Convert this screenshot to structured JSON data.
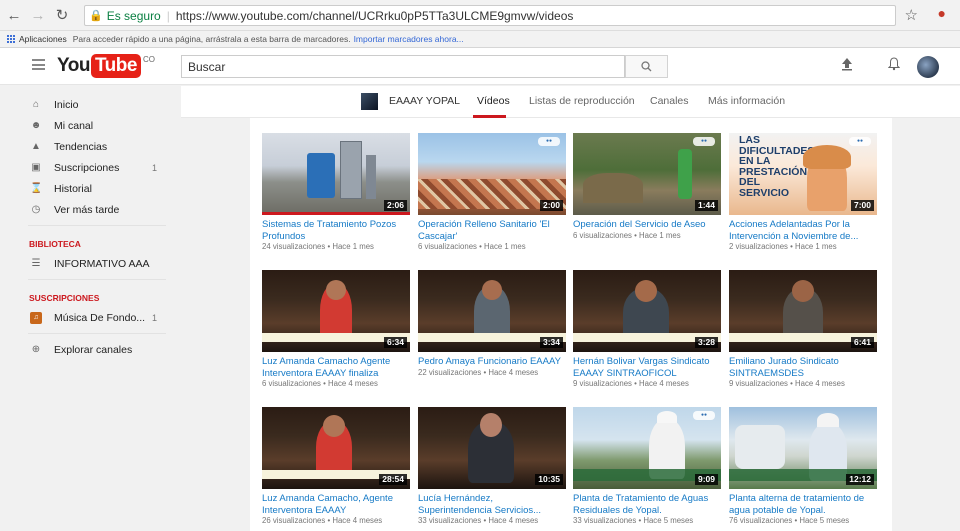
{
  "browser": {
    "secure_label": "Es seguro",
    "url": "https://www.youtube.com/channel/UCRrku0pP5TTa3ULCME9gmvw/videos",
    "bookmarks_apps": "Aplicaciones",
    "bookmarks_hint": "Para acceder rápido a una página, arrástrala a esta barra de marcadores.",
    "bookmarks_import": "Importar marcadores ahora..."
  },
  "masthead": {
    "logo_you": "You",
    "logo_tube": "Tube",
    "logo_region": "CO",
    "search_placeholder": "Buscar"
  },
  "sidebar": {
    "items": [
      {
        "label": "Inicio",
        "icon": "home-icon"
      },
      {
        "label": "Mi canal",
        "icon": "person-icon"
      },
      {
        "label": "Tendencias",
        "icon": "flame-icon"
      },
      {
        "label": "Suscripciones",
        "icon": "subscriptions-icon",
        "count": "1"
      },
      {
        "label": "Historial",
        "icon": "hourglass-icon"
      },
      {
        "label": "Ver más tarde",
        "icon": "clock-icon"
      }
    ],
    "library_header": "BIBLIOTECA",
    "library_item": "INFORMATIVO AAA",
    "subscriptions_header": "SUSCRIPCIONES",
    "subscription_item": "Música De Fondo...",
    "subscription_count": "1",
    "explore": "Explorar canales"
  },
  "channel_nav": {
    "channel_name": "EAAAY YOPAL",
    "tabs": [
      "Vídeos",
      "Listas de reproducción",
      "Canales",
      "Más información"
    ],
    "active_tab": "Vídeos"
  },
  "videos": [
    {
      "title": "Sistemas de Tratamiento Pozos Profundos",
      "meta": "24 visualizaciones • Hace 1 mes",
      "duration": "2:06"
    },
    {
      "title": "Operación Relleno Sanitario 'El Cascajar'",
      "meta": "6 visualizaciones • Hace 1 mes",
      "duration": "2:00"
    },
    {
      "title": "Operación del Servicio de Aseo",
      "meta": "6 visualizaciones • Hace 1 mes",
      "duration": "1:44"
    },
    {
      "title": "Acciones Adelantadas Por la Intervención a Noviembre de...",
      "meta": "2 visualizaciones • Hace 1 mes",
      "duration": "7:00",
      "thumb_text": "LAS DIFICULTADES EN LA PRESTACIÓN DEL SERVICIO"
    },
    {
      "title": "Luz Amanda Camacho Agente Interventora EAAAY finaliza",
      "meta": "6 visualizaciones • Hace 4 meses",
      "duration": "6:34"
    },
    {
      "title": "Pedro Amaya Funcionario EAAAY",
      "meta": "22 visualizaciones • Hace 4 meses",
      "duration": "3:34"
    },
    {
      "title": "Hernán Bolivar Vargas Sindicato EAAAY SINTRAOFICOL",
      "meta": "9 visualizaciones • Hace 4 meses",
      "duration": "3:28"
    },
    {
      "title": "Emiliano Jurado Sindicato SINTRAEMSDES",
      "meta": "9 visualizaciones • Hace 4 meses",
      "duration": "6:41"
    },
    {
      "title": "Luz Amanda Camacho, Agente Interventora EAAAY",
      "meta": "26 visualizaciones • Hace 4 meses",
      "duration": "28:54"
    },
    {
      "title": "Lucía Hernández, Superintendencia Servicios...",
      "meta": "33 visualizaciones • Hace 4 meses",
      "duration": "10:35"
    },
    {
      "title": "Planta de Tratamiento de Aguas Residuales de Yopal.",
      "meta": "33 visualizaciones • Hace 5 meses",
      "duration": "9:09"
    },
    {
      "title": "Planta alterna de tratamiento de agua potable de Yopal.",
      "meta": "76 visualizaciones • Hace 5 meses",
      "duration": "12:12"
    }
  ]
}
